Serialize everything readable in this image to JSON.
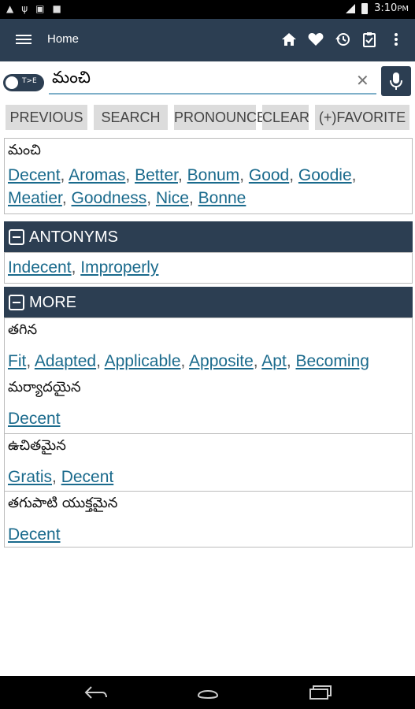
{
  "status_bar": {
    "time": "3:10",
    "ampm": "PM",
    "notification_icons": [
      "warning-icon",
      "usb-icon",
      "lock-icon",
      "image-icon"
    ]
  },
  "app_bar": {
    "title": "Home",
    "actions": [
      "home-icon",
      "heart-icon",
      "history-icon",
      "clipboard-icon",
      "overflow-menu-icon"
    ]
  },
  "search": {
    "toggle_label": "T>E",
    "value": "మంచి",
    "placeholder": ""
  },
  "buttons": {
    "previous": "PREVIOUS",
    "search": "SEARCH",
    "pronounce": "PRONOUNCE",
    "clear": "CLEAR",
    "favorite": "(+)FAVORITE"
  },
  "result": {
    "word": "మంచి",
    "translations": [
      "Decent",
      "Aromas",
      "Better",
      "Bonum",
      "Good",
      "Goodie",
      "Meatier",
      "Goodness",
      "Nice",
      "Bonne"
    ]
  },
  "antonyms": {
    "header": "ANTONYMS",
    "items": [
      "Indecent",
      "Improperly"
    ]
  },
  "more": {
    "header": "MORE",
    "entries": [
      {
        "word": "తగిన",
        "translations": [
          "Fit",
          "Adapted",
          "Applicable",
          "Apposite",
          "Apt",
          "Becoming"
        ]
      },
      {
        "word": "మర్యాదయైన",
        "translations": [
          "Decent"
        ]
      },
      {
        "word": "ఉచితమైన",
        "translations": [
          "Gratis",
          "Decent"
        ]
      },
      {
        "word": "తగుపాటి యుక్తమైన",
        "translations": [
          "Decent"
        ]
      }
    ]
  },
  "colors": {
    "primary": "#2c3e52",
    "link": "#1a6a8c",
    "button_bg": "#dcdcdc"
  }
}
